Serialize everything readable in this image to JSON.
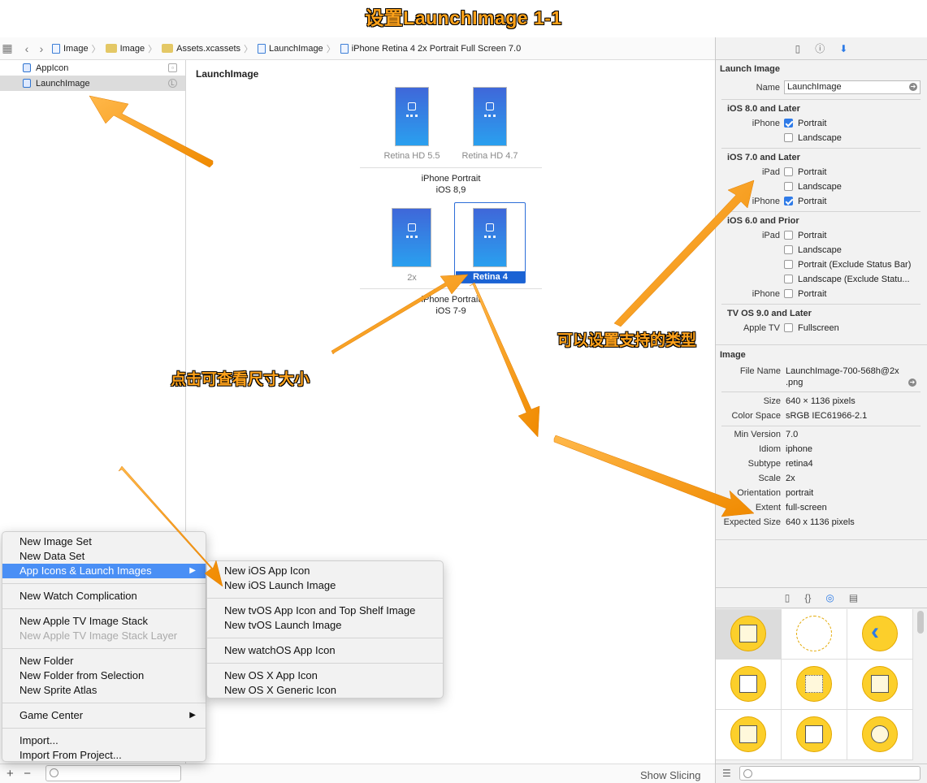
{
  "title": "设置LaunchImage 1-1",
  "pathbar": {
    "crumbs": [
      "Image",
      "Image",
      "Assets.xcassets",
      "LaunchImage",
      "iPhone Retina 4 2x Portrait Full Screen 7.0"
    ]
  },
  "navigator": {
    "items": [
      {
        "label": "AppIcon"
      },
      {
        "label": "LaunchImage"
      }
    ]
  },
  "canvas": {
    "set_name": "LaunchImage",
    "slots_row1": [
      "Retina HD 5.5",
      "Retina HD 4.7"
    ],
    "group1": {
      "line1": "iPhone Portrait",
      "line2": "iOS 8,9"
    },
    "slots_row2": [
      "2x",
      "Retina 4"
    ],
    "group2": {
      "line1": "iPhone Portrait",
      "line2": "iOS 7-9"
    },
    "show_slicing": "Show Slicing"
  },
  "inspector": {
    "section_launch": "Launch Image",
    "name_label": "Name",
    "name_value": "LaunchImage",
    "ios8_title": "iOS 8.0 and Later",
    "ios8_iphone": "iPhone",
    "ios8_portrait": "Portrait",
    "ios8_landscape": "Landscape",
    "ios7_title": "iOS 7.0 and Later",
    "ios7_ipad": "iPad",
    "ios7_ipad_portrait": "Portrait",
    "ios7_ipad_landscape": "Landscape",
    "ios7_iphone": "iPhone",
    "ios7_iphone_portrait": "Portrait",
    "ios6_title": "iOS 6.0 and Prior",
    "ios6_ipad": "iPad",
    "ios6_portrait": "Portrait",
    "ios6_landscape": "Landscape",
    "ios6_portrait_excl": "Portrait (Exclude Status Bar)",
    "ios6_landscape_excl": "Landscape (Exclude Statu...",
    "ios6_iphone": "iPhone",
    "ios6_iphone_portrait": "Portrait",
    "tvos_title": "TV OS 9.0 and Later",
    "tvos_appletv": "Apple TV",
    "tvos_fullscreen": "Fullscreen",
    "section_image": "Image",
    "file_name_label": "File Name",
    "file_name_value1": "LaunchImage-700-568h@2x",
    "file_name_value2": ".png",
    "size_label": "Size",
    "size_value": "640 × 1136 pixels",
    "colorspace_label": "Color Space",
    "colorspace_value": "sRGB IEC61966-2.1",
    "minver_label": "Min Version",
    "minver_value": "7.0",
    "idiom_label": "Idiom",
    "idiom_value": "iphone",
    "subtype_label": "Subtype",
    "subtype_value": "retina4",
    "scale_label": "Scale",
    "scale_value": "2x",
    "orientation_label": "Orientation",
    "orientation_value": "portrait",
    "extent_label": "Extent",
    "extent_value": "full-screen",
    "expected_label": "Expected Size",
    "expected_value": "640 x 1136 pixels"
  },
  "menu_main": [
    {
      "label": "New Image Set"
    },
    {
      "label": "New Data Set"
    },
    {
      "label": "App Icons & Launch Images",
      "sub": "▶"
    },
    {
      "label": "New Watch Complication"
    },
    {
      "label": "New Apple TV Image Stack"
    },
    {
      "label": "New Apple TV Image Stack Layer"
    },
    {
      "label": "New Folder"
    },
    {
      "label": "New Folder from Selection"
    },
    {
      "label": "New Sprite Atlas"
    },
    {
      "label": "Game Center",
      "sub": "▶"
    },
    {
      "label": "Import..."
    },
    {
      "label": "Import From Project..."
    }
  ],
  "menu_sub": [
    {
      "label": "New iOS App Icon"
    },
    {
      "label": "New iOS Launch Image"
    },
    {
      "label": "New tvOS App Icon and Top Shelf Image"
    },
    {
      "label": "New tvOS Launch Image"
    },
    {
      "label": "New watchOS App Icon"
    },
    {
      "label": "New OS X App Icon"
    },
    {
      "label": "New OS X Generic Icon"
    }
  ],
  "notes": {
    "click_size": "点击可查看尺寸大小",
    "set_types": "可以设置支持的类型"
  },
  "colors": {
    "accent": "#ffa21a",
    "selection": "#1b63d4",
    "menu_highlight": "#4a8ff5"
  }
}
